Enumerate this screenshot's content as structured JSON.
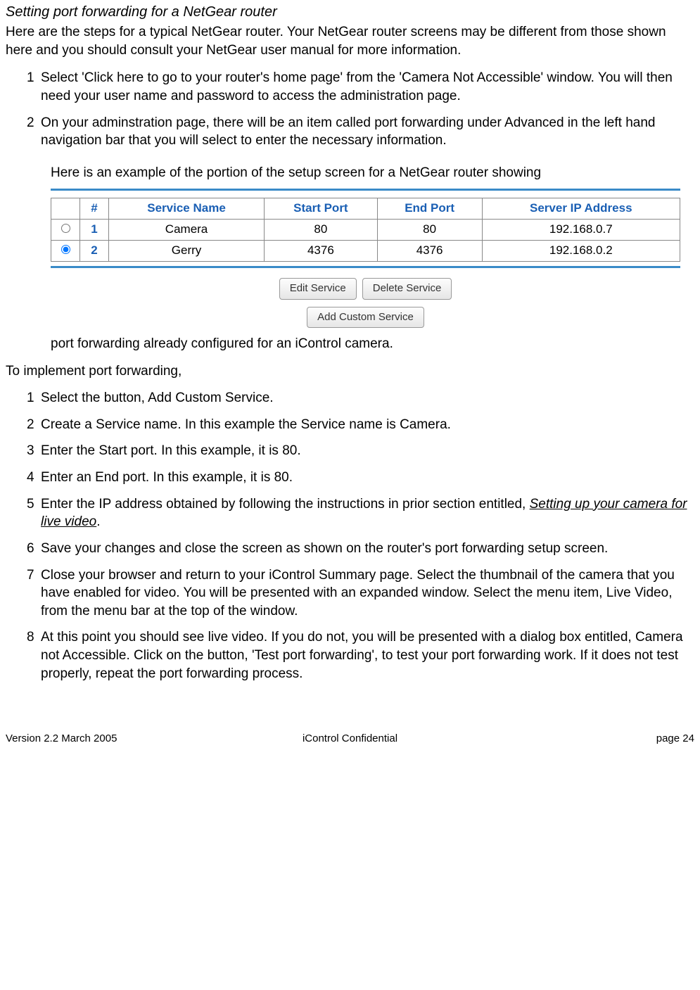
{
  "title": "Setting port forwarding for a NetGear router",
  "intro": " Here are the steps for a typical NetGear router.  Your NetGear router screens may be different from those shown here and you should consult your NetGear user manual for more information.",
  "steps_a": [
    {
      "n": "1",
      "t": "Select 'Click here to go to your router's home page' from the 'Camera Not Accessible' window.  You will then need your user name and password to access the administration page."
    },
    {
      "n": "2",
      "t": "On your adminstration page, there will be an item called port forwarding under Advanced in the left hand navigation bar that you will select to enter the necessary information."
    }
  ],
  "example_intro": "Here is an example of the portion of the setup screen for a NetGear router showing",
  "chart_data": {
    "type": "table",
    "headers": [
      "#",
      "Service Name",
      "Start Port",
      "End Port",
      "Server IP Address"
    ],
    "rows": [
      {
        "selected": false,
        "num": "1",
        "service": "Camera",
        "start": "80",
        "end": "80",
        "ip": "192.168.0.7"
      },
      {
        "selected": true,
        "num": "2",
        "service": "Gerry",
        "start": "4376",
        "end": "4376",
        "ip": "192.168.0.2"
      }
    ],
    "buttons_row1": [
      "Edit Service",
      "Delete Service"
    ],
    "buttons_row2": [
      "Add Custom Service"
    ]
  },
  "example_outro": "port forwarding already configured for an iControl camera.",
  "impl_intro": "To implement port forwarding,",
  "steps_b": [
    {
      "n": "1",
      "t": "Select the button, Add Custom Service."
    },
    {
      "n": "2",
      "t": "Create a Service name.  In this example the Service name is Camera."
    },
    {
      "n": "3",
      "t": "Enter the Start port.  In this example, it is 80."
    },
    {
      "n": "4",
      "t": "Enter an End port.  In this example, it is 80."
    },
    {
      "n": "5",
      "pre": "Enter the IP address obtained by following the instructions in prior section entitled, ",
      "ital": "Setting up your camera for live video",
      "post": "."
    },
    {
      "n": "6",
      "t": "Save your changes and close the screen as shown on the router's port forwarding setup screen."
    },
    {
      "n": "7",
      "t": "Close your browser and return to your iControl Summary page.  Select the thumbnail of the camera that you have enabled for video.  You will be presented with an expanded window.  Select the menu item, Live Video, from the menu bar at the top of the window."
    },
    {
      "n": "8",
      "t": "At this point you should see live video.  If you do not, you will be presented with a dialog box entitled, Camera not Accessible.  Click on the button, 'Test port forwarding', to test your port forwarding work.  If it does not test properly, repeat the port forwarding process."
    }
  ],
  "footer": {
    "left": "Version 2.2 March 2005",
    "center": "iControl     Confidential",
    "right": "page 24"
  }
}
